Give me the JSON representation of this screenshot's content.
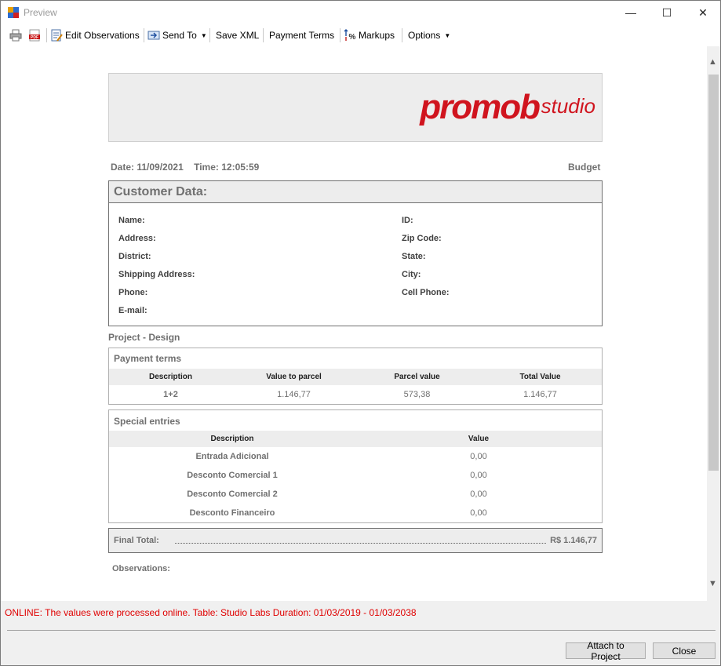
{
  "window": {
    "title": "Preview",
    "minimize": "—",
    "maximize": "☐",
    "close": "✕"
  },
  "toolbar": {
    "edit_observations": "Edit Observations",
    "send_to": "Send To",
    "save_xml": "Save XML",
    "payment_terms": "Payment Terms",
    "markups": "Markups",
    "options": "Options"
  },
  "report": {
    "logo_word": "promob",
    "logo_studio": "studio",
    "date_label": "Date:",
    "date_value": "11/09/2021",
    "time_label": "Time:",
    "time_value": "12:05:59",
    "doc_type": "Budget",
    "customer": {
      "title": "Customer Data:",
      "left_fields": [
        "Name:",
        "Address:",
        "District:",
        "Shipping Address:",
        "Phone:",
        "E-mail:"
      ],
      "right_fields": [
        "ID:",
        "Zip Code:",
        "State:",
        "City:",
        "Cell Phone:"
      ]
    },
    "project_label": "Project - Design",
    "payment_terms": {
      "title": "Payment terms",
      "headers": [
        "Description",
        "Value to parcel",
        "Parcel value",
        "Total Value"
      ],
      "row": [
        "1+2",
        "1.146,77",
        "573,38",
        "1.146,77"
      ]
    },
    "special_entries": {
      "title": "Special entries",
      "headers": [
        "Description",
        "Value"
      ],
      "rows": [
        {
          "description": "Entrada Adicional",
          "value": "0,00"
        },
        {
          "description": "Desconto Comercial 1",
          "value": "0,00"
        },
        {
          "description": "Desconto Comercial 2",
          "value": "0,00"
        },
        {
          "description": "Desconto Financeiro",
          "value": "0,00"
        }
      ]
    },
    "final_total_label": "Final Total:",
    "final_total_value": "R$ 1.146,77",
    "observations_label": "Observations:"
  },
  "status": "ONLINE: The values were processed online. Table: Studio Labs Duration: 01/03/2019 - 01/03/2038",
  "buttons": {
    "attach": "Attach to Project",
    "close": "Close"
  },
  "colors": {
    "brand_red": "#d0141e",
    "status_red": "#e00000",
    "panel_gray": "#ededed"
  }
}
